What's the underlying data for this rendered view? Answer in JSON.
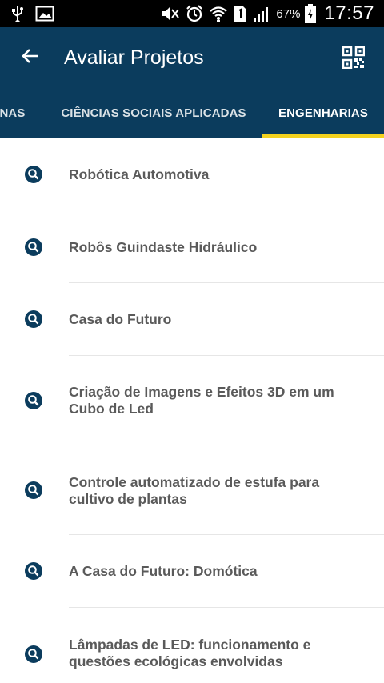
{
  "status_bar": {
    "battery_percent": "67%",
    "time": "17:57",
    "icons": [
      "usb-icon",
      "image-icon",
      "mute-icon",
      "alarm-icon",
      "wifi-icon",
      "sim-icon",
      "signal-icon",
      "battery-icon"
    ]
  },
  "app_bar": {
    "title": "Avaliar Projetos",
    "back_icon": "arrow-back-icon",
    "action_icon": "qr-code-icon"
  },
  "tabs": [
    {
      "label": "ANAS",
      "active": false
    },
    {
      "label": "CIÊNCIAS SOCIAIS APLICADAS",
      "active": false
    },
    {
      "label": "ENGENHARIAS",
      "active": true
    }
  ],
  "colors": {
    "primary": "#0b3c5d",
    "accent": "#f4d21e",
    "text": "#5a5a5a"
  },
  "projects": [
    {
      "title": "Robótica Automotiva",
      "icon": "search-icon"
    },
    {
      "title": "Robôs Guindaste Hidráulico",
      "icon": "search-icon"
    },
    {
      "title": "Casa do Futuro",
      "icon": "search-icon"
    },
    {
      "title": "Criação de Imagens e Efeitos 3D em um Cubo de Led",
      "icon": "search-icon"
    },
    {
      "title": "Controle automatizado de estufa para cultivo de plantas",
      "icon": "search-icon"
    },
    {
      "title": "A Casa do Futuro: Domótica",
      "icon": "search-icon"
    },
    {
      "title": "Lâmpadas de LED: funcionamento e questões ecológicas envolvidas",
      "icon": "search-icon"
    }
  ]
}
